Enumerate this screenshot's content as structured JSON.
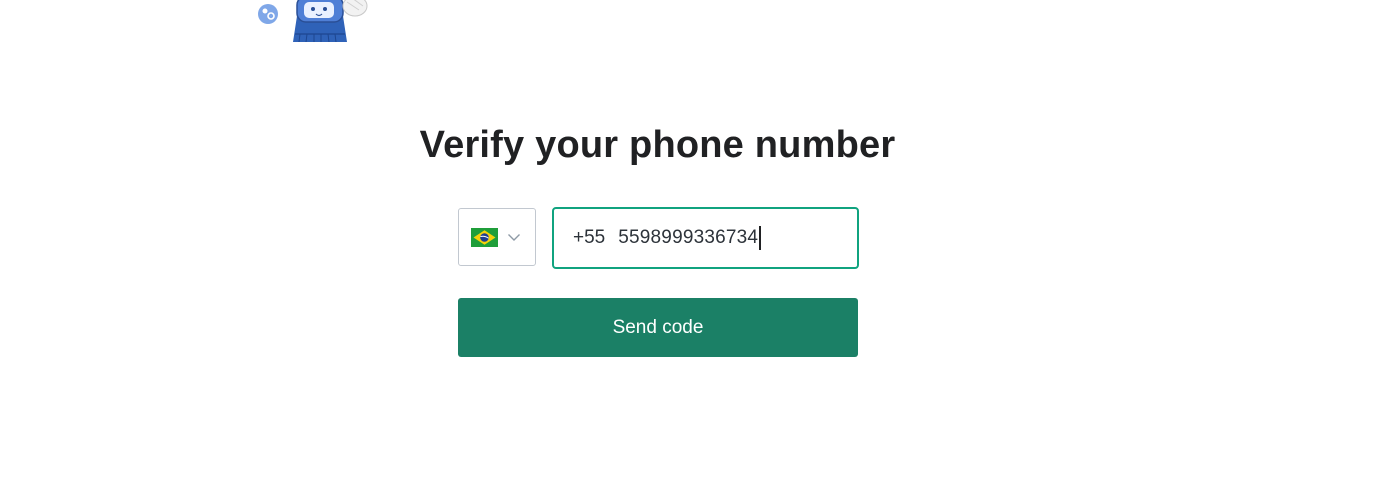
{
  "page": {
    "title": "Verify your phone number"
  },
  "phone_form": {
    "country": {
      "flag_icon": "brazil-flag-icon",
      "dropdown_icon": "chevron-down-icon"
    },
    "dial_code": "+55",
    "phone_number": "5598999336734",
    "send_label": "Send code"
  },
  "colors": {
    "accent_border": "#10a37f",
    "button_bg": "#1b8066",
    "button_text": "#ffffff",
    "title_text": "#202123"
  },
  "decor": {
    "mascot_icon": "mascot-sticker-icon"
  }
}
